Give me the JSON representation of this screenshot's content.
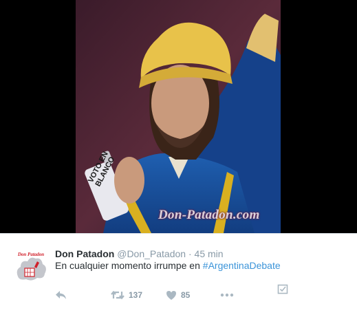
{
  "media": {
    "watermark": "Don-Patadon.com",
    "can_label": "VOTO EN BLANCO"
  },
  "tweet": {
    "avatar_text": "Don Patadon",
    "name": "Don Patadon",
    "handle": "@Don_Patadon",
    "separator": "·",
    "time": "45 min",
    "text": "En cualquier momento irrumpe en ",
    "hashtag": "#ArgentinaDebate"
  },
  "actions": {
    "reply_icon": "reply-icon",
    "retweet_icon": "retweet-icon",
    "retweet_count": "137",
    "like_icon": "heart-icon",
    "like_count": "85",
    "more_icon": "more-dots-icon",
    "activity_icon": "analytics-checkbox-icon"
  },
  "colors": {
    "name": "#292f33",
    "muted": "#8899a6",
    "hashtag": "#3b94d9",
    "action_icon": "#aab8c2"
  }
}
